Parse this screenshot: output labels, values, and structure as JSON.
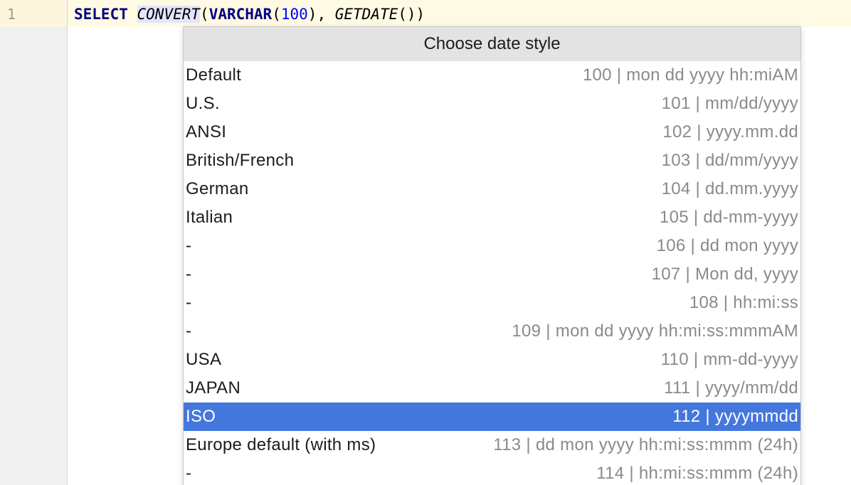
{
  "editor": {
    "line_number": "1",
    "code": {
      "select": "SELECT",
      "convert": "CONVERT",
      "open1": "(",
      "varchar": "VARCHAR",
      "open2": "(",
      "num": "100",
      "close2": "), ",
      "getdate": "GETDATE",
      "parens": "())"
    }
  },
  "popup": {
    "title": "Choose date style",
    "items": [
      {
        "label": "Default",
        "value": "100 | mon dd yyyy hh:miAM"
      },
      {
        "label": "U.S.",
        "value": "101 | mm/dd/yyyy"
      },
      {
        "label": "ANSI",
        "value": "102 | yyyy.mm.dd"
      },
      {
        "label": "British/French",
        "value": "103 | dd/mm/yyyy"
      },
      {
        "label": "German",
        "value": "104 | dd.mm.yyyy"
      },
      {
        "label": "Italian",
        "value": "105 | dd-mm-yyyy"
      },
      {
        "label": "-",
        "value": "106 | dd mon yyyy"
      },
      {
        "label": "-",
        "value": "107 | Mon dd, yyyy"
      },
      {
        "label": "-",
        "value": "108 | hh:mi:ss"
      },
      {
        "label": "-",
        "value": "109 | mon dd yyyy hh:mi:ss:mmmAM"
      },
      {
        "label": "USA",
        "value": "110 | mm-dd-yyyy"
      },
      {
        "label": "JAPAN",
        "value": "111 | yyyy/mm/dd"
      },
      {
        "label": "ISO",
        "value": "112 | yyyymmdd"
      },
      {
        "label": "Europe default (with ms)",
        "value": "113 | dd mon yyyy hh:mi:ss:mmm (24h)"
      },
      {
        "label": "-",
        "value": "114 | hh:mi:ss:mmm (24h)"
      }
    ],
    "selected_index": 12
  },
  "colors": {
    "selection": "#4477dd",
    "keyword": "#000080",
    "number": "#0000ff",
    "current_line": "#fffae3"
  }
}
